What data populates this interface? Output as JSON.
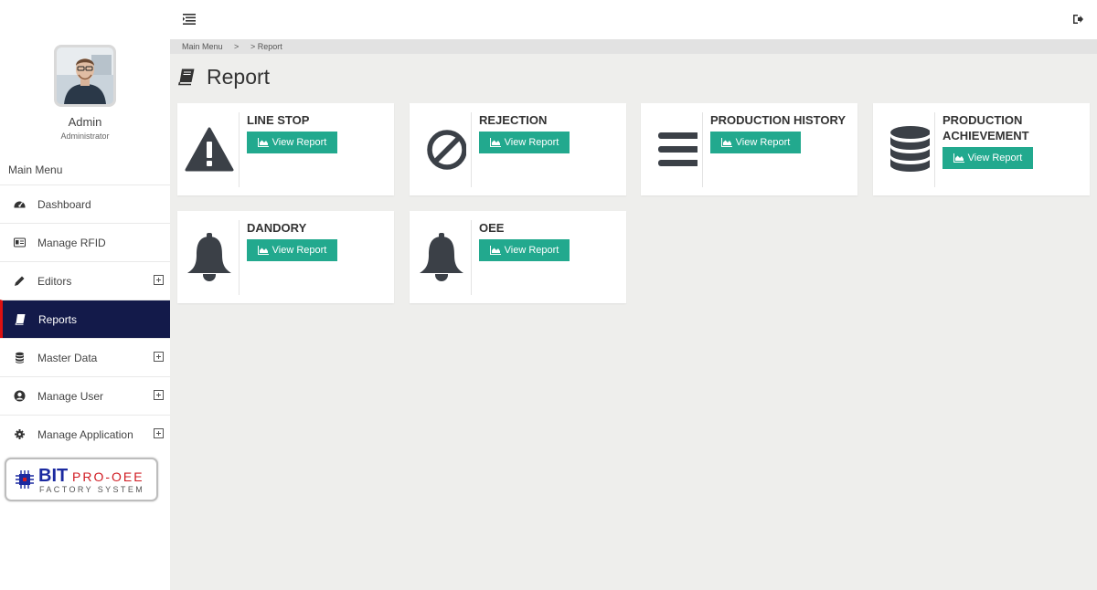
{
  "breadcrumb": {
    "root": "Main Menu",
    "sep": ">",
    "current": "> Report"
  },
  "user": {
    "name": "Admin",
    "role": "Administrator"
  },
  "sidebar": {
    "title": "Main Menu",
    "items": [
      {
        "label": "Dashboard",
        "icon": "dashboard-icon"
      },
      {
        "label": "Manage RFID",
        "icon": "id-card-icon"
      },
      {
        "label": "Editors",
        "icon": "pencil-icon",
        "expandable": true
      },
      {
        "label": "Reports",
        "icon": "book-icon",
        "active": true
      },
      {
        "label": "Master Data",
        "icon": "database-icon",
        "expandable": true
      },
      {
        "label": "Manage User",
        "icon": "user-circle-icon",
        "expandable": true
      },
      {
        "label": "Manage Application",
        "icon": "gear-icon",
        "expandable": true
      }
    ]
  },
  "brand": {
    "bit": "BIT",
    "pro": "PRO-OEE",
    "factory": "FACTORY SYSTEM"
  },
  "page": {
    "title": "Report"
  },
  "cards": [
    {
      "title": "LINE STOP",
      "button": "View Report",
      "icon": "warning-icon"
    },
    {
      "title": "REJECTION",
      "button": "View Report",
      "icon": "ban-icon"
    },
    {
      "title": "PRODUCTION HISTORY",
      "button": "View Report",
      "icon": "bars-icon"
    },
    {
      "title": "PRODUCTION ACHIEVEMENT",
      "button": "View Report",
      "icon": "database-icon"
    },
    {
      "title": "DANDORY",
      "button": "View Report",
      "icon": "bell-icon"
    },
    {
      "title": "OEE",
      "button": "View Report",
      "icon": "bell-icon"
    }
  ],
  "colors": {
    "accent": "#22a98e",
    "sidebar_active": "#131a4a",
    "active_marker": "#dd1111",
    "icon_dark": "#3b4047"
  }
}
